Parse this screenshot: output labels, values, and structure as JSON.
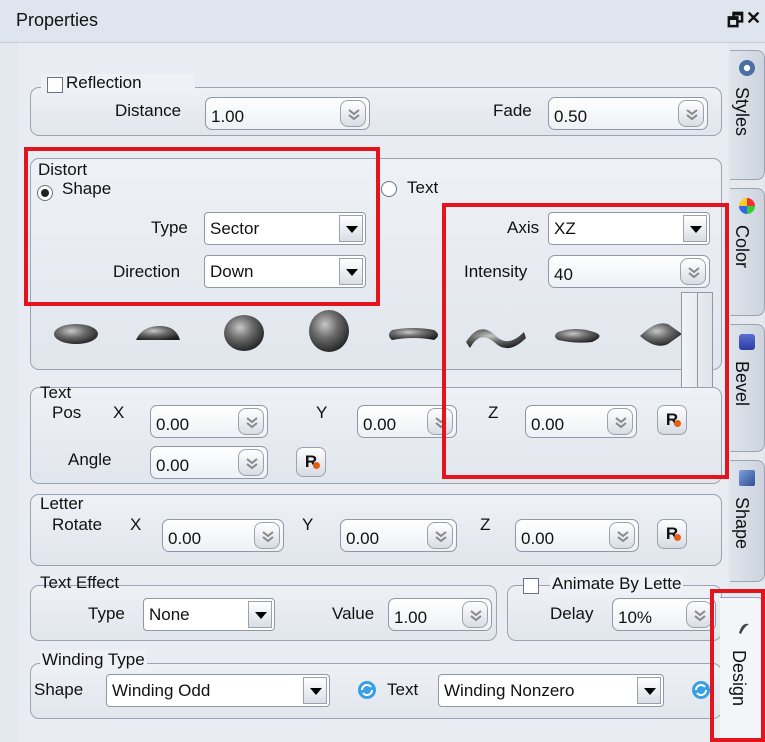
{
  "window": {
    "title": "Properties",
    "restore_icon": "restore-icon",
    "close_icon": "close-icon"
  },
  "reflection": {
    "label": "Reflection",
    "checked": false,
    "distance_label": "Distance",
    "distance_value": "1.00",
    "fade_label": "Fade",
    "fade_value": "0.50"
  },
  "distort": {
    "label": "Distort",
    "shape_radio": "Shape",
    "text_radio": "Text",
    "selected": "Shape",
    "type_label": "Type",
    "type_value": "Sector",
    "direction_label": "Direction",
    "direction_value": "Down",
    "axis_label": "Axis",
    "axis_value": "XZ",
    "intensity_label": "Intensity",
    "intensity_value": "40"
  },
  "shape_presets": [
    "ellipse",
    "lens",
    "sphere-small",
    "sphere-large",
    "capsule",
    "wave",
    "pinch",
    "point"
  ],
  "text": {
    "label": "Text",
    "pos_label": "Pos",
    "x_label": "X",
    "y_label": "Y",
    "z_label": "Z",
    "pos_x": "0.00",
    "pos_y": "0.00",
    "pos_z": "0.00",
    "angle_label": "Angle",
    "angle_value": "0.00",
    "reset_label": "R"
  },
  "letter": {
    "label": "Letter",
    "rotate_label": "Rotate",
    "x_label": "X",
    "y_label": "Y",
    "z_label": "Z",
    "x": "0.00",
    "y": "0.00",
    "z": "0.00",
    "reset_label": "R"
  },
  "text_effect": {
    "label": "Text Effect",
    "type_label": "Type",
    "type_value": "None",
    "value_label": "Value",
    "value": "1.00"
  },
  "animate": {
    "label": "Animate By Lette",
    "checked": false,
    "delay_label": "Delay",
    "delay_value": "10%"
  },
  "winding": {
    "label": "Winding Type",
    "shape_label": "Shape",
    "shape_value": "Winding Odd",
    "text_label": "Text",
    "text_value": "Winding Nonzero"
  },
  "tabs": [
    "Styles",
    "Color",
    "Bevel",
    "Shape",
    "Design"
  ],
  "colors": {
    "highlight": "#e4141e",
    "accent": "#e25f12"
  }
}
